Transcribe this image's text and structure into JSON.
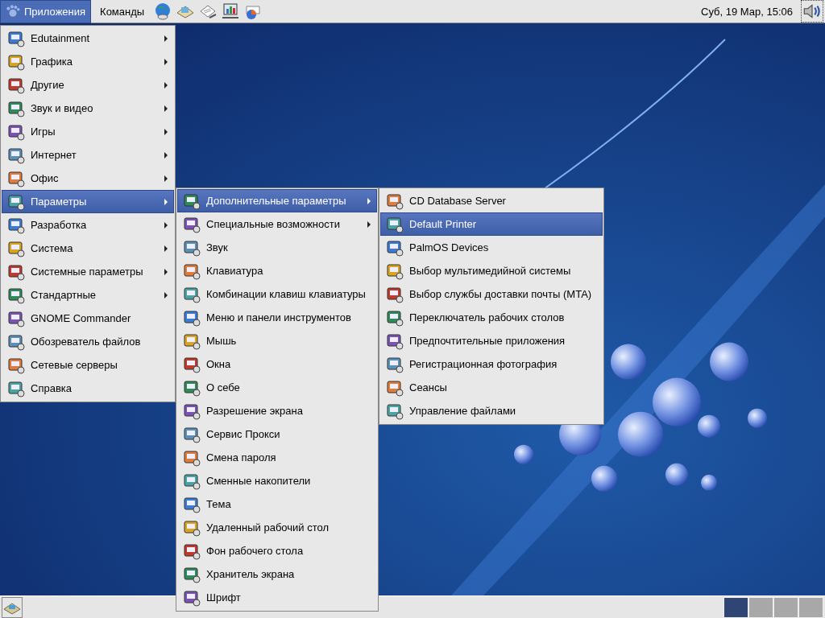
{
  "top_panel": {
    "menus": [
      {
        "label": "Приложения",
        "selected": true
      },
      {
        "label": "Команды",
        "selected": false
      }
    ],
    "clock": "Суб, 19 Мар, 15:06"
  },
  "menus": [
    {
      "items": [
        {
          "label": "Edutainment",
          "submenu": true,
          "selected": false
        },
        {
          "label": "Графика",
          "submenu": true,
          "selected": false
        },
        {
          "label": "Другие",
          "submenu": true,
          "selected": false
        },
        {
          "label": "Звук и видео",
          "submenu": true,
          "selected": false
        },
        {
          "label": "Игры",
          "submenu": true,
          "selected": false
        },
        {
          "label": "Интернет",
          "submenu": true,
          "selected": false
        },
        {
          "label": "Офис",
          "submenu": true,
          "selected": false
        },
        {
          "label": "Параметры",
          "submenu": true,
          "selected": true
        },
        {
          "label": "Разработка",
          "submenu": true,
          "selected": false
        },
        {
          "label": "Система",
          "submenu": true,
          "selected": false
        },
        {
          "label": "Системные параметры",
          "submenu": true,
          "selected": false
        },
        {
          "label": "Стандартные",
          "submenu": true,
          "selected": false
        },
        {
          "label": "GNOME Commander",
          "submenu": false,
          "selected": false
        },
        {
          "label": "Обозреватель файлов",
          "submenu": false,
          "selected": false
        },
        {
          "label": "Сетевые серверы",
          "submenu": false,
          "selected": false
        },
        {
          "label": "Справка",
          "submenu": false,
          "selected": false
        }
      ]
    },
    {
      "items": [
        {
          "label": "Дополнительные параметры",
          "submenu": true,
          "selected": true
        },
        {
          "label": "Специальные возможности",
          "submenu": true,
          "selected": false
        },
        {
          "label": "Звук",
          "submenu": false,
          "selected": false
        },
        {
          "label": "Клавиатура",
          "submenu": false,
          "selected": false
        },
        {
          "label": "Комбинации клавиш клавиатуры",
          "submenu": false,
          "selected": false
        },
        {
          "label": "Меню и панели инструментов",
          "submenu": false,
          "selected": false
        },
        {
          "label": "Мышь",
          "submenu": false,
          "selected": false
        },
        {
          "label": "Окна",
          "submenu": false,
          "selected": false
        },
        {
          "label": "О себе",
          "submenu": false,
          "selected": false
        },
        {
          "label": "Разрешение экрана",
          "submenu": false,
          "selected": false
        },
        {
          "label": "Сервис Прокси",
          "submenu": false,
          "selected": false
        },
        {
          "label": "Смена пароля",
          "submenu": false,
          "selected": false
        },
        {
          "label": "Сменные накопители",
          "submenu": false,
          "selected": false
        },
        {
          "label": "Тема",
          "submenu": false,
          "selected": false
        },
        {
          "label": "Удаленный рабочий стол",
          "submenu": false,
          "selected": false
        },
        {
          "label": "Фон рабочего стола",
          "submenu": false,
          "selected": false
        },
        {
          "label": "Хранитель экрана",
          "submenu": false,
          "selected": false
        },
        {
          "label": "Шрифт",
          "submenu": false,
          "selected": false
        }
      ]
    },
    {
      "items": [
        {
          "label": "CD Database Server",
          "submenu": false,
          "selected": false
        },
        {
          "label": "Default Printer",
          "submenu": false,
          "selected": true
        },
        {
          "label": "PalmOS Devices",
          "submenu": false,
          "selected": false
        },
        {
          "label": "Выбор мультимедийной системы",
          "submenu": false,
          "selected": false
        },
        {
          "label": "Выбор службы доставки почты (MTA)",
          "submenu": false,
          "selected": false
        },
        {
          "label": "Переключатель рабочих столов",
          "submenu": false,
          "selected": false
        },
        {
          "label": "Предпочтительные приложения",
          "submenu": false,
          "selected": false
        },
        {
          "label": "Регистрационная фотография",
          "submenu": false,
          "selected": false
        },
        {
          "label": "Сеансы",
          "submenu": false,
          "selected": false
        },
        {
          "label": "Управление файлами",
          "submenu": false,
          "selected": false
        }
      ]
    }
  ],
  "bottom_panel": {
    "workspaces": [
      {
        "selected": true
      },
      {
        "selected": false
      },
      {
        "selected": false
      },
      {
        "selected": false
      }
    ]
  }
}
